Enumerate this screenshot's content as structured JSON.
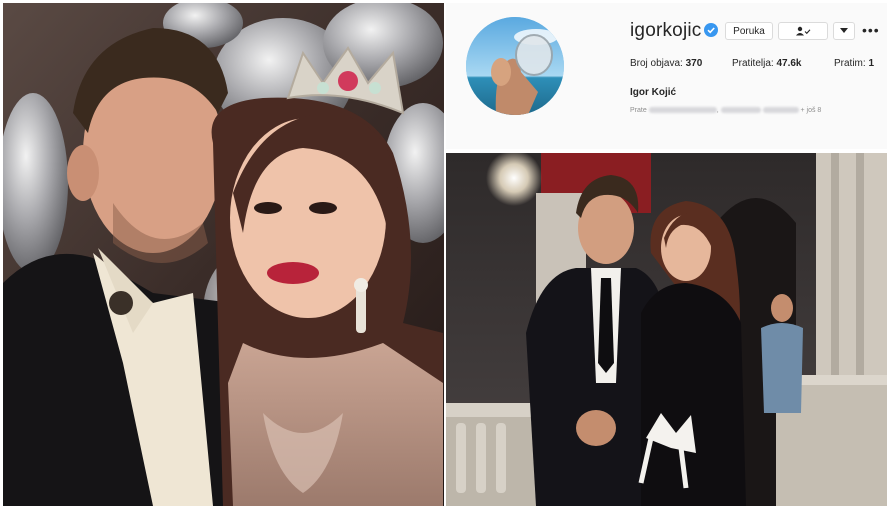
{
  "profile": {
    "username": "igorkojic",
    "message_button": "Poruka",
    "posts_label": "Broj objava:",
    "posts_value": "370",
    "followers_label": "Pratitelja:",
    "followers_value": "47.6k",
    "following_label": "Pratim:",
    "following_value": "1",
    "full_name": "Igor Kojić",
    "followed_by_label": "Prate",
    "followed_by_more": "+ još 8"
  },
  "colors": {
    "verified": "#3897f0",
    "text_primary": "#262626",
    "text_secondary": "#8e8e8e",
    "border": "#dbdbdb"
  },
  "icons": {
    "verified": "verified-badge-icon",
    "following": "user-check-icon",
    "dropdown": "chevron-down-icon",
    "more": "more-dots-icon"
  }
}
